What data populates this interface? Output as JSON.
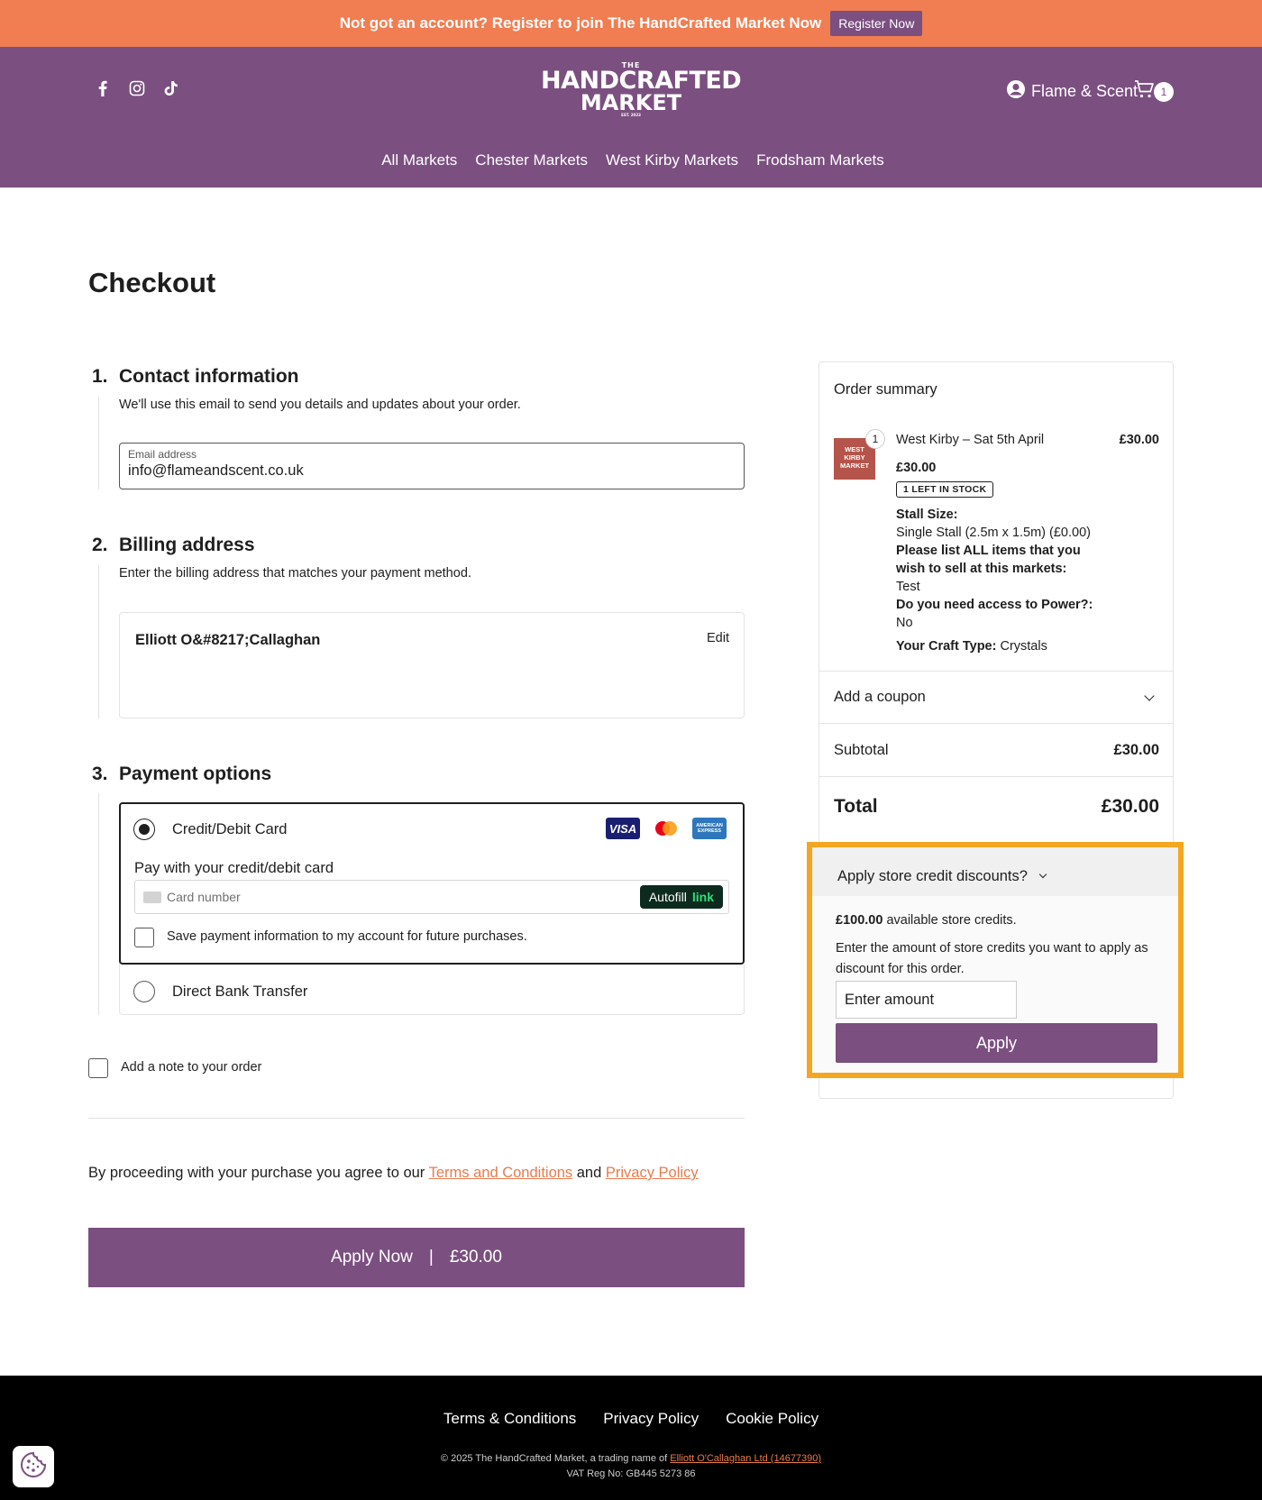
{
  "promo": {
    "text": "Not got an account? Register to join The HandCrafted Market Now",
    "button": "Register Now"
  },
  "header": {
    "social_icons": [
      "facebook-icon",
      "instagram-icon",
      "tiktok-icon"
    ],
    "logo": {
      "the": "THE",
      "line1": "HANDCRAFTED",
      "line2": "MARKET",
      "est": "EST. 2023"
    },
    "account_name": "Flame & Scent",
    "cart_count": "1",
    "nav": [
      "All Markets",
      "Chester Markets",
      "West Kirby Markets",
      "Frodsham Markets"
    ]
  },
  "checkout": {
    "title": "Checkout",
    "contact": {
      "num": "1.",
      "title": "Contact information",
      "desc": "We'll use this email to send you details and updates about your order.",
      "email_label": "Email address",
      "email_value": "info@flameandscent.co.uk"
    },
    "billing": {
      "num": "2.",
      "title": "Billing address",
      "desc": "Enter the billing address that matches your payment method.",
      "name": "Elliott O&#8217;Callaghan",
      "edit": "Edit"
    },
    "payment": {
      "num": "3.",
      "title": "Payment options",
      "card_label": "Credit/Debit Card",
      "card_brands": [
        "VISA",
        "",
        "AMERICAN EXPRESS"
      ],
      "card_sub": "Pay with your credit/debit card",
      "card_placeholder": "Card number",
      "autofill": "Autofill",
      "autofill_link": "link",
      "save_info": "Save payment information to my account for future purchases.",
      "bank_label": "Direct Bank Transfer",
      "selected": "Credit/Debit Card"
    },
    "note_label": "Add a note to your order",
    "terms": {
      "prefix": "By proceeding with your purchase you agree to our ",
      "terms_link": "Terms and Conditions",
      "and": " and ",
      "privacy_link": "Privacy Policy"
    },
    "submit": {
      "label": "Apply Now",
      "sep": "|",
      "amount": "£30.00"
    }
  },
  "summary": {
    "title": "Order summary",
    "item": {
      "thumb_text": "WEST KIRBY MARKET",
      "qty": "1",
      "name": "West Kirby – Sat 5th April",
      "price": "£30.00",
      "unit_price": "£30.00",
      "stock": "1 LEFT IN STOCK",
      "stall_label": "Stall Size:",
      "stall_value": "Single Stall (2.5m x 1.5m) (£0.00)",
      "items_label": "Please list ALL items that you wish to sell at this markets:",
      "items_value": "Test",
      "power_label": "Do you need access to Power?:",
      "power_value": "No",
      "craft_label": "Your Craft Type:",
      "craft_value": " Crystals"
    },
    "coupon": "Add a coupon",
    "subtotal_label": "Subtotal",
    "subtotal_value": "£30.00",
    "total_label": "Total",
    "total_value": "£30.00",
    "credit": {
      "heading": "Apply store credit discounts?",
      "available_amount": "£100.00",
      "available_text": " available store credits.",
      "desc": "Enter the amount of store credits you want to apply as discount for this order.",
      "placeholder": "Enter amount",
      "button": "Apply"
    }
  },
  "footer": {
    "links": [
      "Terms & Conditions",
      "Privacy Policy",
      "Cookie Policy"
    ],
    "copy_prefix": "© 2025 The HandCrafted Market, a trading name of ",
    "copy_link": "Elliott O'Callaghan Ltd (14677390)",
    "vat": "VAT Reg No: GB445 5273 86"
  },
  "colors": {
    "brand": "#7b4f80",
    "promo": "#f07e52",
    "highlight": "#f4a621",
    "link": "#e87a4d"
  }
}
